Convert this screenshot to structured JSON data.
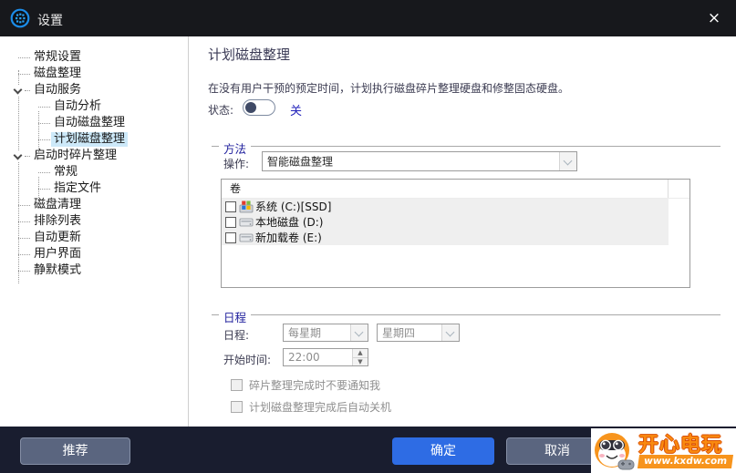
{
  "titlebar": {
    "title": "设置",
    "close": "×"
  },
  "sidebar": {
    "items": [
      {
        "label": "常规设置"
      },
      {
        "label": "磁盘整理"
      },
      {
        "label": "自动服务"
      },
      {
        "label": "自动分析"
      },
      {
        "label": "自动磁盘整理"
      },
      {
        "label": "计划磁盘整理"
      },
      {
        "label": "启动时碎片整理"
      },
      {
        "label": "常规"
      },
      {
        "label": "指定文件"
      },
      {
        "label": "磁盘清理"
      },
      {
        "label": "排除列表"
      },
      {
        "label": "自动更新"
      },
      {
        "label": "用户界面"
      },
      {
        "label": "静默模式"
      }
    ]
  },
  "content": {
    "title": "计划磁盘整理",
    "description": "在没有用户干预的预定时间，计划执行磁盘碎片整理硬盘和修整固态硬盘。",
    "status": {
      "label": "状态:",
      "value": "关",
      "on": false
    }
  },
  "method": {
    "legend": "方法",
    "operation_label": "操作:",
    "operation_value": "智能磁盘整理",
    "volume_header": "卷",
    "volumes": [
      {
        "name": "系统 (C:)[SSD]",
        "checked": false,
        "icon": "system-drive-icon"
      },
      {
        "name": "本地磁盘 (D:)",
        "checked": false,
        "icon": "drive-icon"
      },
      {
        "name": "新加载卷 (E:)",
        "checked": false,
        "icon": "drive-icon"
      }
    ]
  },
  "schedule": {
    "legend": "日程",
    "row_label": "日程:",
    "frequency_value": "每星期",
    "day_value": "星期四",
    "start_time_label": "开始时间:",
    "start_time_value": "22:00",
    "options": [
      {
        "label": "碎片整理完成时不要通知我",
        "checked": false
      },
      {
        "label": "计划磁盘整理完成后自动关机",
        "checked": false
      }
    ]
  },
  "footer": {
    "recommend": "推荐",
    "ok": "确定",
    "cancel": "取消"
  },
  "watermark": {
    "brand": "开心电玩",
    "url": "www.kxdw.com"
  },
  "colors": {
    "accent_blue": "#2e6ce4",
    "titlebar_bg": "#17181c",
    "footer_bg": "#191d2f",
    "selected_item_bg": "#cde9f9",
    "legend_blue": "#22229e",
    "brand_orange": "#f7941d"
  }
}
